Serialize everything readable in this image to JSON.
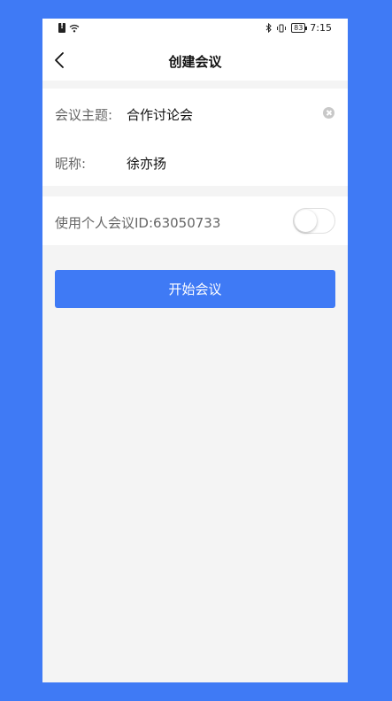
{
  "status_bar": {
    "time": "7:15",
    "battery": "83",
    "icons": [
      "sim-alert-icon",
      "wifi-icon",
      "bluetooth-icon",
      "vibrate-icon",
      "battery-icon"
    ]
  },
  "nav": {
    "title": "创建会议",
    "back_icon": "chevron-left-icon"
  },
  "form": {
    "topic_label": "会议主题:",
    "topic_value": "合作讨论会",
    "nickname_label": "昵称:",
    "nickname_value": "徐亦扬",
    "clear_icon": "clear-circle-icon"
  },
  "personal_meeting": {
    "label": "使用个人会议ID:63050733",
    "enabled": false
  },
  "actions": {
    "start_label": "开始会议"
  },
  "colors": {
    "accent": "#3f7af5",
    "background": "#f4f4f4",
    "card": "#ffffff"
  }
}
